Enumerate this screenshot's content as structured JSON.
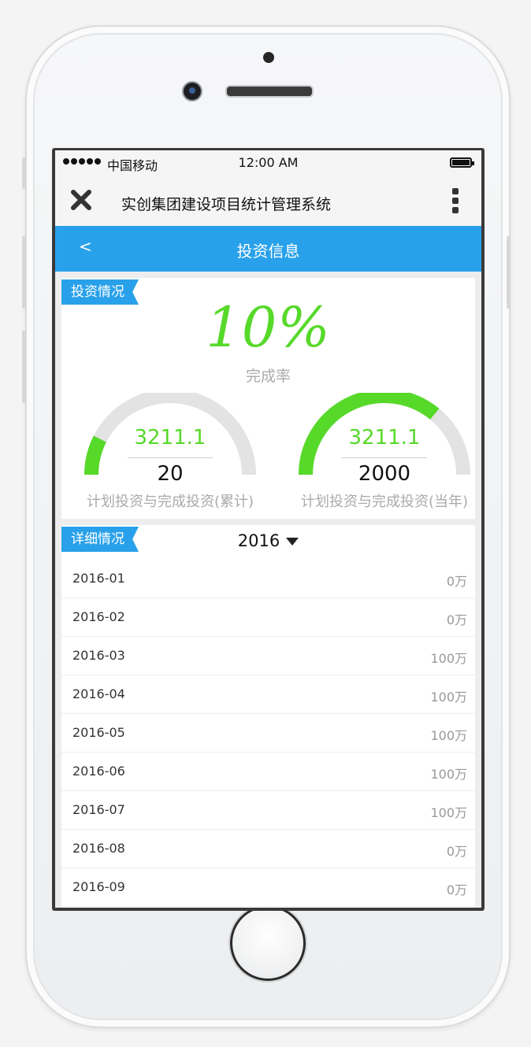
{
  "status_bar": {
    "carrier": "中国移动",
    "time": "12:00 AM"
  },
  "app_header": {
    "title": "实创集团建设项目统计管理系统"
  },
  "nav": {
    "back": "<",
    "title": "投资信息"
  },
  "investment": {
    "section_tag": "投资情况",
    "completion_rate": "10%",
    "completion_label": "完成率",
    "gauges": [
      {
        "value": "3211.1",
        "total": "20",
        "caption": "计划投资与完成投资(累计)",
        "fill_fraction": 0.15
      },
      {
        "value": "3211.1",
        "total": "2000",
        "caption": "计划投资与完成投资(当年)",
        "fill_fraction": 0.72
      }
    ],
    "colors": {
      "accent_green": "#57d92a",
      "track_gray": "#e3e3e3",
      "brand_blue": "#29a1ea"
    }
  },
  "details": {
    "section_tag": "详细情况",
    "year": "2016",
    "rows": [
      {
        "month": "2016-01",
        "amount": "0万"
      },
      {
        "month": "2016-02",
        "amount": "0万"
      },
      {
        "month": "2016-03",
        "amount": "100万"
      },
      {
        "month": "2016-04",
        "amount": "100万"
      },
      {
        "month": "2016-05",
        "amount": "100万"
      },
      {
        "month": "2016-06",
        "amount": "100万"
      },
      {
        "month": "2016-07",
        "amount": "100万"
      },
      {
        "month": "2016-08",
        "amount": "0万"
      },
      {
        "month": "2016-09",
        "amount": "0万"
      }
    ]
  }
}
